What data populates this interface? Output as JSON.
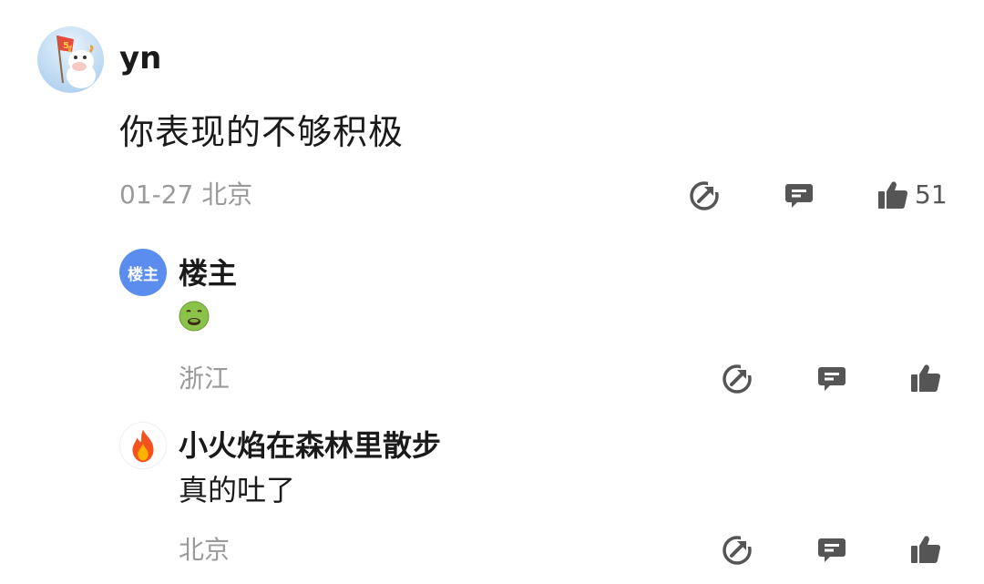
{
  "comment": {
    "username": "yn",
    "text": "你表现的不够积极",
    "meta": "01-27 北京",
    "like_count": "51",
    "avatar_icon": "cartoon-cow-flag-avatar"
  },
  "replies": [
    {
      "avatar_text": "楼主",
      "name": "楼主",
      "text_icon": "nauseated-face-emoji",
      "meta": "浙江"
    },
    {
      "avatar_icon": "fire-emoji",
      "name": "小火焰在森林里散步",
      "text": "真的吐了",
      "meta": "北京"
    }
  ],
  "colors": {
    "meta_gray": "#9a9a9a",
    "icon_gray": "#555555",
    "louzhu_blue": "#5b8def"
  },
  "icons": [
    "share-icon",
    "comment-icon",
    "like-icon"
  ]
}
